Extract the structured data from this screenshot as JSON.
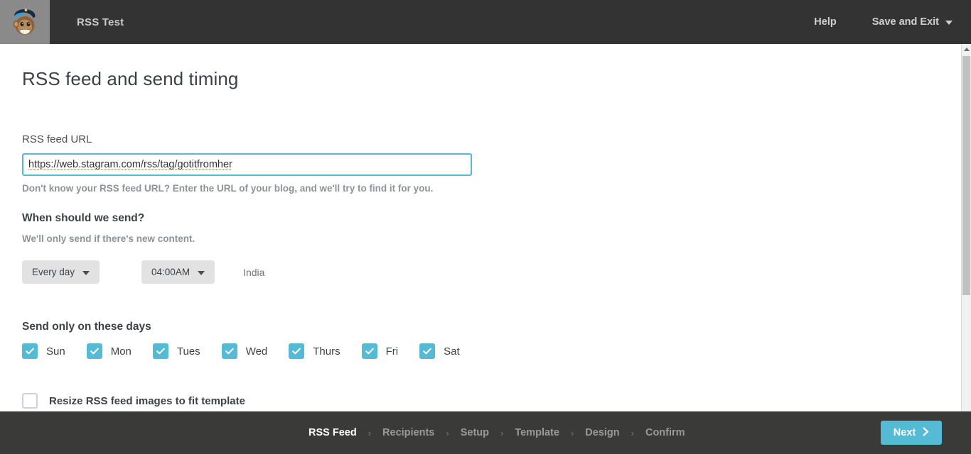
{
  "header": {
    "logo_alt": "Mailchimp Freddie logo",
    "brand_title": "RSS Test",
    "help_label": "Help",
    "save_and_exit_label": "Save and Exit"
  },
  "main": {
    "page_title": "RSS feed and send timing",
    "rss_url_label": "RSS feed URL",
    "rss_url_value": "https://web.stagram.com/rss/tag/gotitfromher",
    "rss_url_placeholder": "http://",
    "rss_url_help": "Don't know your RSS feed URL? Enter the URL of your blog, and we'll try to find it for you.",
    "when_heading": "When should we send?",
    "when_subtext": "We'll only send if there's new content.",
    "frequency_value": "Every day",
    "time_value": "04:00AM",
    "timezone_label": "India",
    "days_heading": "Send only on these days",
    "days": [
      {
        "label": "Sun",
        "checked": true
      },
      {
        "label": "Mon",
        "checked": true
      },
      {
        "label": "Tues",
        "checked": true
      },
      {
        "label": "Wed",
        "checked": true
      },
      {
        "label": "Thurs",
        "checked": true
      },
      {
        "label": "Fri",
        "checked": true
      },
      {
        "label": "Sat",
        "checked": true
      }
    ],
    "resize_label": "Resize RSS feed images to fit template",
    "resize_checked": false
  },
  "footer": {
    "steps": [
      {
        "label": "RSS Feed",
        "active": true
      },
      {
        "label": "Recipients",
        "active": false
      },
      {
        "label": "Setup",
        "active": false
      },
      {
        "label": "Template",
        "active": false
      },
      {
        "label": "Design",
        "active": false
      },
      {
        "label": "Confirm",
        "active": false
      }
    ],
    "separator": "›",
    "next_label": "Next"
  },
  "colors": {
    "header_bg": "#333333",
    "footer_bg": "#3a3a38",
    "accent_teal": "#55bad3",
    "logo_tile_bg": "#8a8a8a",
    "text_dark": "#3c4247",
    "text_muted": "#8e9397"
  }
}
